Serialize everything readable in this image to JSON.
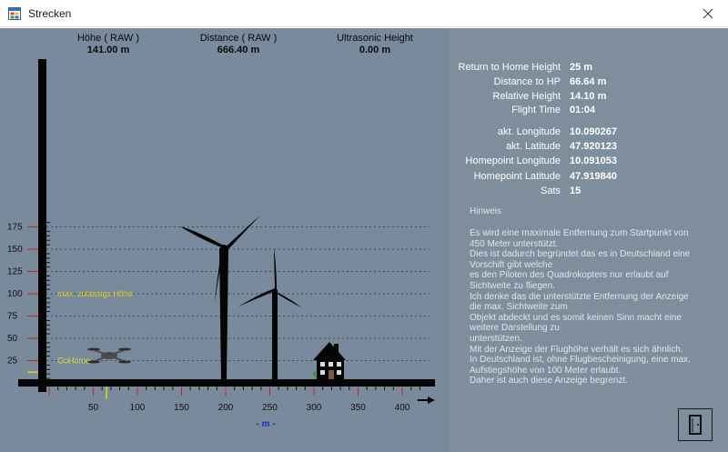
{
  "window": {
    "title": "Strecken",
    "icon": "app-icon",
    "close_icon": "close-icon"
  },
  "chart_header": [
    {
      "label": "Höhe ( RAW )",
      "value": "141.00 m"
    },
    {
      "label": "Distance ( RAW )",
      "value": "666.40 m"
    },
    {
      "label": "Ultrasonic Height",
      "value": "0.00 m"
    }
  ],
  "chart_data": {
    "type": "line",
    "title": "",
    "y_ticks": [
      25,
      50,
      75,
      100,
      125,
      150,
      175
    ],
    "ylim": [
      0,
      175
    ],
    "x_ticks": [
      50,
      100,
      150,
      200,
      250,
      300,
      350,
      400
    ],
    "xlabel": "- m -",
    "grid": true,
    "reference_lines": [
      {
        "label": "max. zulässigs Höhe",
        "value": 100,
        "color": "#e0d020"
      },
      {
        "label": "GoHome",
        "value": 25,
        "color": "#d8e040"
      }
    ],
    "markers": {
      "drone_height": 12,
      "drone_distance_marker": 65
    },
    "colors": {
      "background": "#788a9c",
      "axis": "#050505",
      "grid": "#3f4a54",
      "tick_red": "#cc2222"
    }
  },
  "info_panel": {
    "rows": [
      {
        "label": "Return to Home Height",
        "value": "25 m"
      },
      {
        "label": "Distance to HP",
        "value": "66.64 m"
      },
      {
        "label": "Relative Height",
        "value": "14.10 m"
      },
      {
        "label": "Flight Time",
        "value": "01:04"
      },
      {
        "label": "akt. Longitude",
        "value": "10.090267"
      },
      {
        "label": "akt. Latitude",
        "value": "47.920123"
      },
      {
        "label": "Homepoint Longitude",
        "value": "10.091053"
      },
      {
        "label": "Homepoint Latitude",
        "value": "47.919840"
      },
      {
        "label": "Sats",
        "value": "15"
      }
    ],
    "hinweis_title": "Hinweis",
    "hinweis_lines": [
      "Es wird eine maximale Entfernung zum Startpunkt von",
      "450 Meter unterstützt.",
      "Dies ist dadurch begründet das es in Deutschland eine",
      "Vorschift gibt welche",
      "es den Piloten des Quadrokopters nur erlaubt auf",
      "Sichtweite zu fliegen.",
      "Ich denke das die unterstützte Entfernung der Anzeige",
      "die max. Sichtweite zum",
      "Objekt abdeckt und es somit keinen Sinn macht eine",
      "weitere Darstellung zu",
      "unterstützen.",
      "Mit der Anzeige der Flughöhe verhält es sich ähnlich.",
      "In Deutschland ist, ohne Flugbescheinigung, eine max.",
      "Aufstiegshöhe von 100 Meter erlaubt.",
      "Daher ist auch diese Anzeige begrenzt."
    ],
    "exit_icon": "exit-door-icon"
  }
}
